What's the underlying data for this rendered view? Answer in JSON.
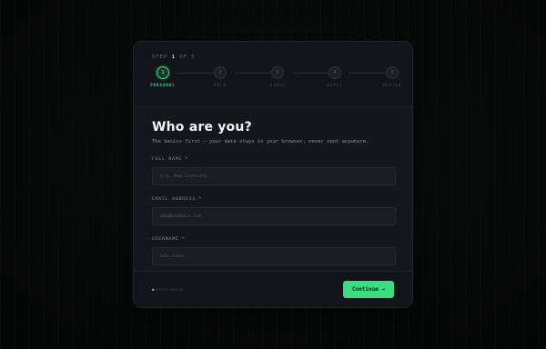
{
  "header": {
    "step_prefix": "STEP",
    "current_step": "1",
    "step_of": "OF 5"
  },
  "stepper": [
    {
      "number": "1",
      "label": "PERSONAL",
      "active": true
    },
    {
      "number": "2",
      "label": "ROLE",
      "active": false
    },
    {
      "number": "3",
      "label": "VIBES",
      "active": false
    },
    {
      "number": "4",
      "label": "GOALS",
      "active": false
    },
    {
      "number": "5",
      "label": "REVIEW",
      "active": false
    }
  ],
  "main": {
    "title": "Who are you?",
    "subtitle": "The basics first — your data stays in your browser, never sent anywhere."
  },
  "fields": [
    {
      "label": "FULL NAME",
      "required_mark": "*",
      "placeholder": "e.g. Ada Lovelace"
    },
    {
      "label": "EMAIL ADDRESS",
      "required_mark": "*",
      "placeholder": "ada@example.com"
    },
    {
      "label": "USERNAME",
      "required_mark": "*",
      "placeholder": "ada_codes"
    }
  ],
  "footer": {
    "autosave_mark": "●",
    "autosave_text": "Auto-saved",
    "continue_label": "Continue →"
  },
  "colors": {
    "accent": "#3ddc84",
    "card": "#16171c",
    "background": "#070908"
  }
}
